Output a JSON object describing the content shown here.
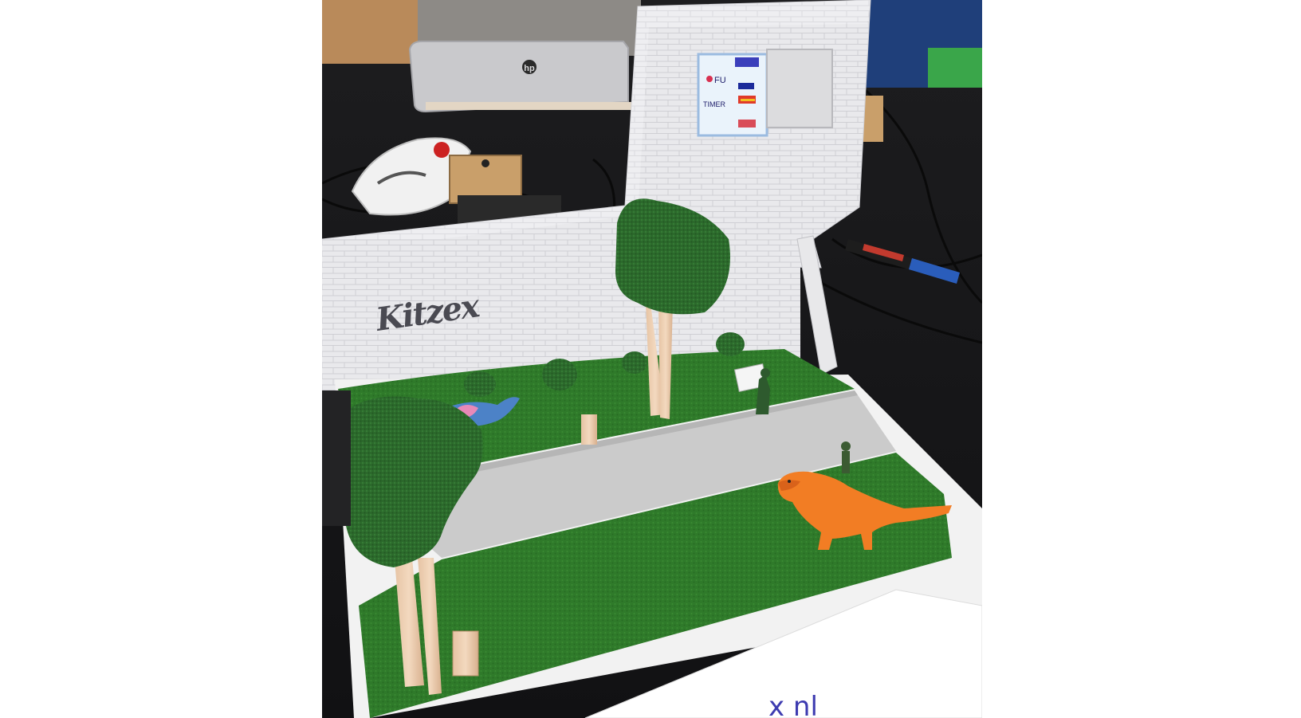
{
  "photo": {
    "graffiti_tag": "Kitzex",
    "laptop_logo": "hp",
    "paper_text": "x nl",
    "screen_words": [
      "FU",
      "TIMER"
    ]
  }
}
